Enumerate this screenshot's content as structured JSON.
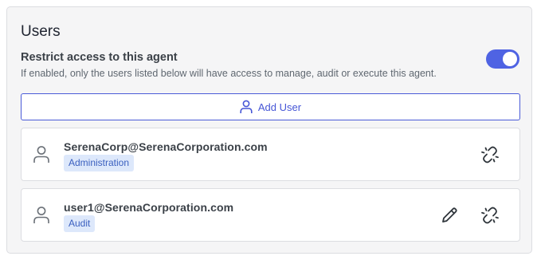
{
  "section": {
    "title": "Users"
  },
  "restrict": {
    "label": "Restrict access to this agent",
    "description": "If enabled, only the users listed below will have access to manage, audit or execute this agent.",
    "enabled": true
  },
  "add_user": {
    "label": "Add User",
    "icon": "user-icon"
  },
  "users": [
    {
      "email": "SerenaCorp@SerenaCorporation.com",
      "role": "Administration",
      "actions": [
        "unlink-icon"
      ]
    },
    {
      "email": "user1@SerenaCorporation.com",
      "role": "Audit",
      "actions": [
        "pencil-icon",
        "unlink-icon"
      ]
    }
  ],
  "colors": {
    "accent": "#4f63e3",
    "badge_bg": "#dde8fb",
    "badge_text": "#3a5fbf"
  }
}
